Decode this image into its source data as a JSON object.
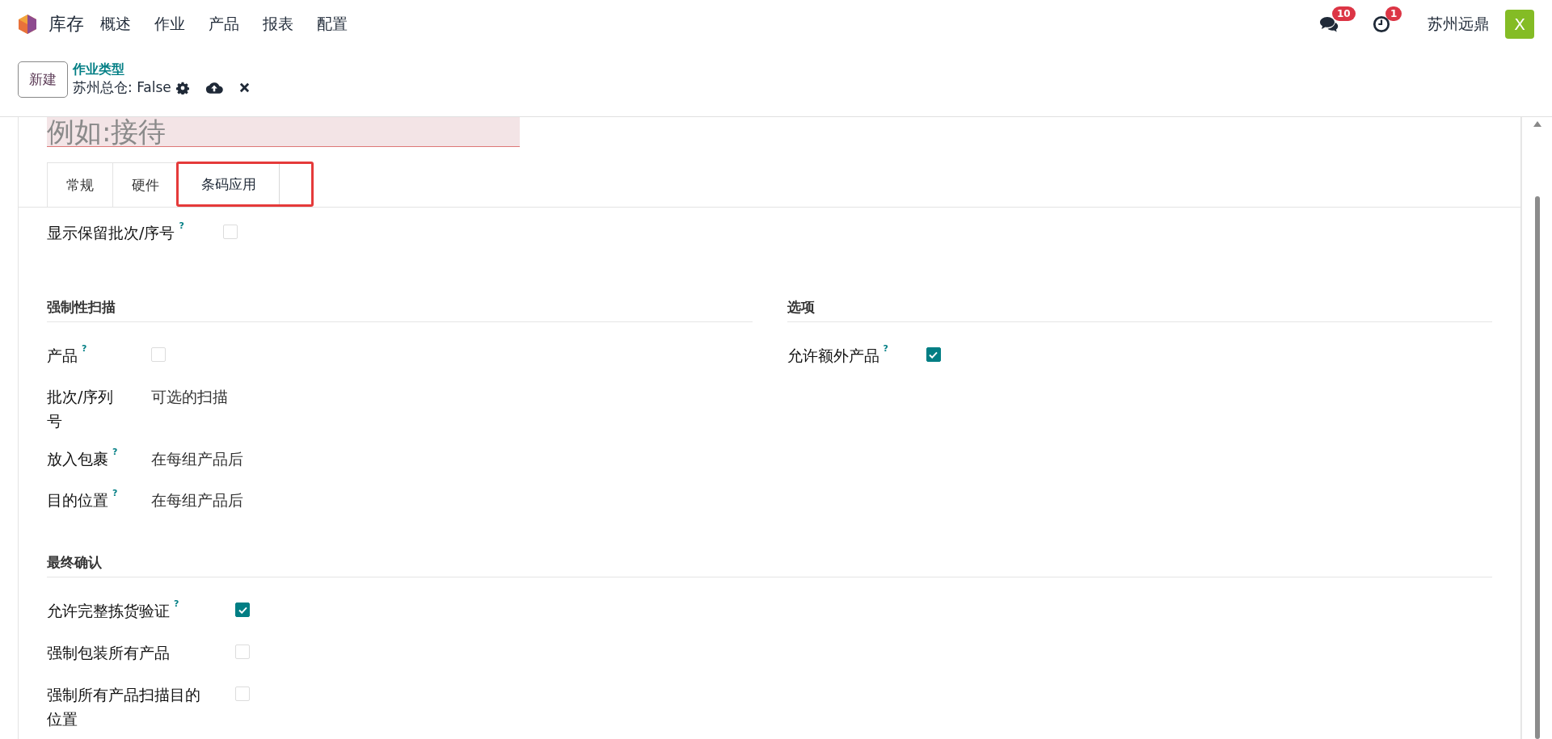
{
  "navbar": {
    "app_name": "库存",
    "menu": [
      "概述",
      "作业",
      "产品",
      "报表",
      "配置"
    ],
    "messages_badge": "10",
    "activities_badge": "1",
    "company": "苏州远鼎",
    "avatar": "X"
  },
  "control_panel": {
    "new_button": "新建",
    "breadcrumb": "作业类型",
    "record": "苏州总仓: False"
  },
  "name_field": {
    "placeholder": "例如:接待"
  },
  "tabs": [
    {
      "label": "常规",
      "selected": false,
      "highlighted": false
    },
    {
      "label": "硬件",
      "selected": false,
      "highlighted": false
    },
    {
      "label": "条码应用",
      "selected": true,
      "highlighted": true
    }
  ],
  "top_fields": [
    {
      "label": "显示保留批次/序号",
      "help": "?",
      "kind": "checkbox",
      "checked": false
    }
  ],
  "section_rows": [
    [
      {
        "title": "强制性扫描",
        "fields": [
          {
            "label": "产品",
            "help": "?",
            "kind": "checkbox",
            "checked": false
          },
          {
            "label": "批次/序列号",
            "kind": "value",
            "value": "可选的扫描"
          },
          {
            "label": "放入包裹",
            "help": "?",
            "kind": "value",
            "value": "在每组产品后"
          },
          {
            "label": "目的位置",
            "help": "?",
            "kind": "value",
            "value": "在每组产品后"
          }
        ]
      },
      {
        "title": "选项",
        "fields": [
          {
            "label": "允许额外产品",
            "help": "?",
            "kind": "checkbox",
            "checked": true
          }
        ]
      }
    ],
    [
      {
        "title": "最终确认",
        "fields": [
          {
            "label": "允许完整拣货验证",
            "help": "?",
            "kind": "checkbox",
            "checked": true
          },
          {
            "label": "强制包装所有产品",
            "kind": "checkbox",
            "checked": false
          },
          {
            "label": "强制所有产品扫描目的位置",
            "kind": "checkbox",
            "checked": false
          }
        ]
      }
    ]
  ]
}
